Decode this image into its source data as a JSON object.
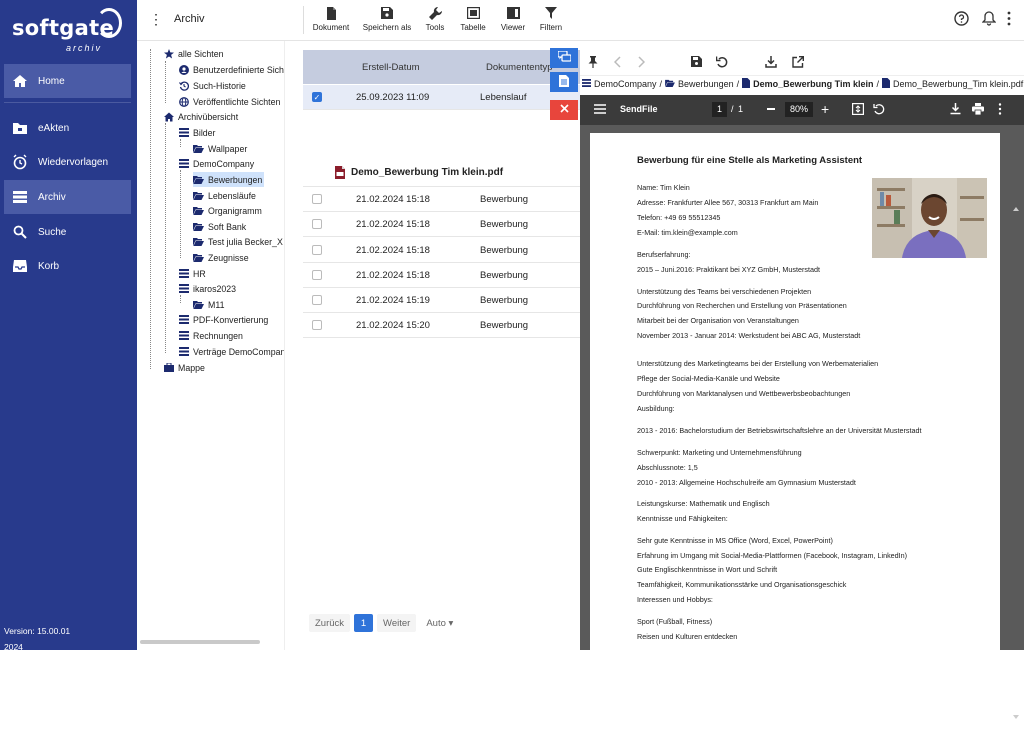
{
  "brand": {
    "line1": "softgate",
    "line2": "archiv"
  },
  "nav": [
    {
      "label": "Home",
      "icon": "home-icon"
    },
    {
      "label": "eAkten",
      "icon": "folder-icon"
    },
    {
      "label": "Wiedervorlagen",
      "icon": "alarm-clock-icon"
    },
    {
      "label": "Archiv",
      "icon": "list-icon"
    },
    {
      "label": "Suche",
      "icon": "search-icon"
    },
    {
      "label": "Korb",
      "icon": "inbox-icon"
    }
  ],
  "version": {
    "line1": "Version: 15.00.01",
    "line2": "2024"
  },
  "header": {
    "title": "Archiv",
    "tools": [
      "Dokument",
      "Speichern als",
      "Tools",
      "Tabelle",
      "Viewer",
      "Filtern"
    ]
  },
  "tree": [
    "alle Sichten",
    "Benutzerdefinierte Sichten",
    "Such-Historie",
    "Veröffentlichte Sichten",
    "Archivübersicht",
    "Bilder",
    "Wallpaper",
    "DemoCompany",
    "Bewerbungen",
    "Lebensläufe",
    "Organigramm",
    "Soft Bank",
    "Test julia Becker_X",
    "Zeugnisse",
    "HR",
    "ikaros2023",
    "M11",
    "PDF-Konvertierung",
    "Rechnungen",
    "Verträge DemoCompany",
    "Mappe"
  ],
  "grid": {
    "columns": [
      "Erstell-Datum",
      "Dokumententyp"
    ],
    "selected_row": {
      "date": "25.09.2023 11:09",
      "type": "Lebenslauf"
    },
    "attachment": "Demo_Bewerbung Tim klein.pdf",
    "rows": [
      {
        "date": "21.02.2024 15:18",
        "type": "Bewerbung"
      },
      {
        "date": "21.02.2024 15:18",
        "type": "Bewerbung"
      },
      {
        "date": "21.02.2024 15:18",
        "type": "Bewerbung"
      },
      {
        "date": "21.02.2024 15:18",
        "type": "Bewerbung"
      },
      {
        "date": "21.02.2024 15:19",
        "type": "Bewerbung"
      },
      {
        "date": "21.02.2024 15:20",
        "type": "Bewerbung"
      }
    ],
    "pager": {
      "prev": "Zurück",
      "page": "1",
      "next": "Weiter",
      "size": "Auto"
    }
  },
  "viewer": {
    "breadcrumb": [
      "DemoCompany",
      "Bewerbungen",
      "Demo_Bewerbung Tim klein",
      "Demo_Bewerbung_Tim klein.pdf"
    ],
    "pdf": {
      "app": "SendFile",
      "page": "1",
      "pages": "1",
      "zoom": "80%"
    },
    "doc": {
      "title": "Bewerbung für eine Stelle als Marketing Assistent",
      "lines": [
        "Name: Tim Klein",
        "Adresse: Frankfurter Allee 567, 30313 Frankfurt am Main",
        "Telefon: +49 69 55512345",
        "E-Mail: tim.klein@example.com",
        "Berufserfahrung:",
        "2015 – Juni.2016: Praktikant bei XYZ GmbH, Musterstadt",
        "Unterstützung des Teams bei verschiedenen Projekten",
        "Durchführung von Recherchen und Erstellung von Präsentationen",
        "Mitarbeit bei der Organisation von Veranstaltungen",
        "November 2013 - Januar 2014: Werkstudent bei ABC AG, Musterstadt",
        "Unterstützung des Marketingteams bei der Erstellung von Werbematerialien",
        "Pflege der Social-Media-Kanäle und Website",
        "Durchführung von Marktanalysen und Wettbewerbsbeobachtungen",
        "Ausbildung:",
        "2013 - 2016: Bachelorstudium der Betriebswirtschaftslehre an der Universität Musterstadt",
        "Schwerpunkt: Marketing und Unternehmensführung",
        "Abschlussnote: 1,5",
        "2010 - 2013: Allgemeine Hochschulreife am Gymnasium Musterstadt",
        "Leistungskurse: Mathematik und Englisch",
        "Kenntnisse und Fähigkeiten:",
        "Sehr gute Kenntnisse in MS Office (Word, Excel, PowerPoint)",
        "Erfahrung im Umgang mit Social-Media-Plattformen (Facebook, Instagram, LinkedIn)",
        "Gute Englischkenntnisse in Wort und Schrift",
        "Teamfähigkeit, Kommunikationsstärke und Organisationsgeschick",
        "Interessen und Hobbys:",
        "Sport (Fußball, Fitness)",
        "Reisen und Kulturen entdecken"
      ]
    }
  }
}
